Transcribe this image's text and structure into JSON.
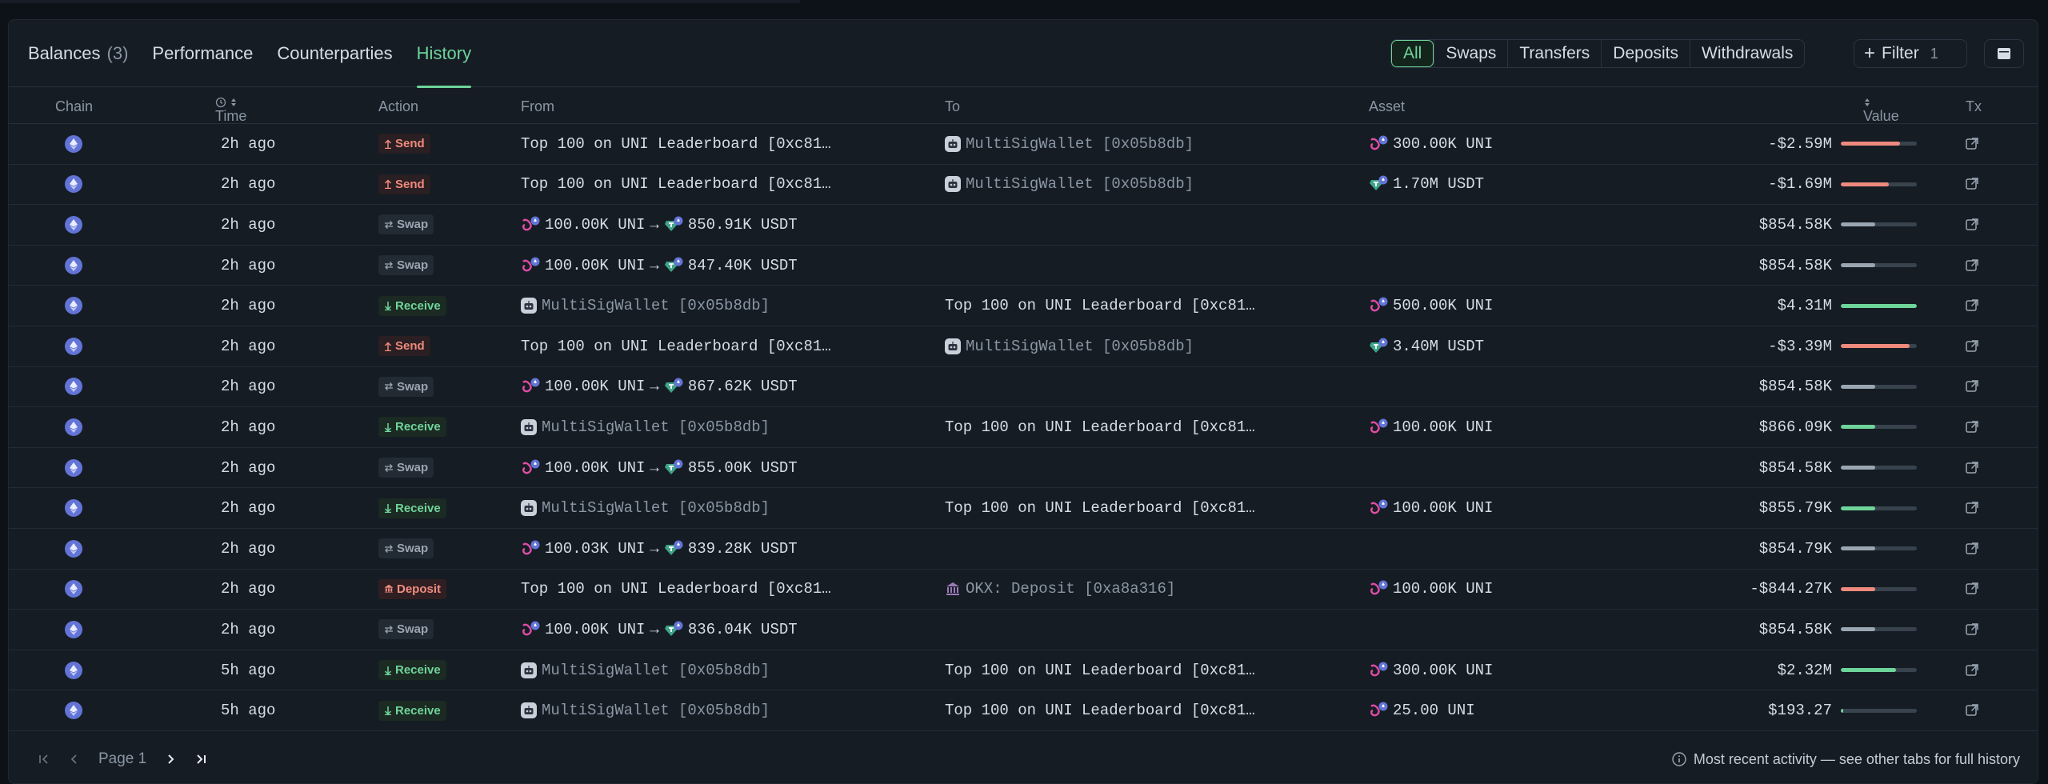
{
  "tabs": [
    {
      "label": "Balances",
      "count": "(3)"
    },
    {
      "label": "Performance",
      "count": ""
    },
    {
      "label": "Counterparties",
      "count": ""
    },
    {
      "label": "History",
      "count": ""
    }
  ],
  "active_tab": "History",
  "segments": [
    "All",
    "Swaps",
    "Transfers",
    "Deposits",
    "Withdrawals"
  ],
  "active_segment": "All",
  "filter": {
    "label": "Filter",
    "count": "1"
  },
  "columns": {
    "chain": "Chain",
    "time": "Time",
    "action": "Action",
    "from": "From",
    "to": "To",
    "asset": "Asset",
    "value": "Value",
    "tx": "Tx"
  },
  "rows": [
    {
      "time": "2h ago",
      "action": "Send",
      "kind": "send",
      "from": "Top 100 on UNI Leaderboard [0xc81…",
      "to": "MultiSigWallet [0x05b8db]",
      "asset": "300.00K UNI",
      "asset_token": "uni",
      "value": "-$2.59M",
      "bar": 0.78,
      "bar_color": "#ee8a7d"
    },
    {
      "time": "2h ago",
      "action": "Send",
      "kind": "send",
      "from": "Top 100 on UNI Leaderboard [0xc81…",
      "to": "MultiSigWallet [0x05b8db]",
      "asset": "1.70M USDT",
      "asset_token": "usdt",
      "value": "-$1.69M",
      "bar": 0.63,
      "bar_color": "#ee8a7d"
    },
    {
      "time": "2h ago",
      "action": "Swap",
      "kind": "swap",
      "from_swap_in": "100.00K UNI",
      "from_swap_out": "850.91K USDT",
      "value": "$854.58K",
      "bar": 0.45,
      "bar_color": "#9aa6b2"
    },
    {
      "time": "2h ago",
      "action": "Swap",
      "kind": "swap",
      "from_swap_in": "100.00K UNI",
      "from_swap_out": "847.40K USDT",
      "value": "$854.58K",
      "bar": 0.45,
      "bar_color": "#9aa6b2"
    },
    {
      "time": "2h ago",
      "action": "Receive",
      "kind": "receive",
      "from": "MultiSigWallet [0x05b8db]",
      "to": "Top 100 on UNI Leaderboard [0xc81…",
      "asset": "500.00K UNI",
      "asset_token": "uni",
      "value": "$4.31M",
      "bar": 1.0,
      "bar_color": "#6fd49a"
    },
    {
      "time": "2h ago",
      "action": "Send",
      "kind": "send",
      "from": "Top 100 on UNI Leaderboard [0xc81…",
      "to": "MultiSigWallet [0x05b8db]",
      "asset": "3.40M USDT",
      "asset_token": "usdt",
      "value": "-$3.39M",
      "bar": 0.9,
      "bar_color": "#ee8a7d"
    },
    {
      "time": "2h ago",
      "action": "Swap",
      "kind": "swap",
      "from_swap_in": "100.00K UNI",
      "from_swap_out": "867.62K USDT",
      "value": "$854.58K",
      "bar": 0.45,
      "bar_color": "#9aa6b2"
    },
    {
      "time": "2h ago",
      "action": "Receive",
      "kind": "receive",
      "from": "MultiSigWallet [0x05b8db]",
      "to": "Top 100 on UNI Leaderboard [0xc81…",
      "asset": "100.00K UNI",
      "asset_token": "uni",
      "value": "$866.09K",
      "bar": 0.45,
      "bar_color": "#6fd49a"
    },
    {
      "time": "2h ago",
      "action": "Swap",
      "kind": "swap",
      "from_swap_in": "100.00K UNI",
      "from_swap_out": "855.00K USDT",
      "value": "$854.58K",
      "bar": 0.45,
      "bar_color": "#9aa6b2"
    },
    {
      "time": "2h ago",
      "action": "Receive",
      "kind": "receive",
      "from": "MultiSigWallet [0x05b8db]",
      "to": "Top 100 on UNI Leaderboard [0xc81…",
      "asset": "100.00K UNI",
      "asset_token": "uni",
      "value": "$855.79K",
      "bar": 0.45,
      "bar_color": "#6fd49a"
    },
    {
      "time": "2h ago",
      "action": "Swap",
      "kind": "swap",
      "from_swap_in": "100.03K UNI",
      "from_swap_out": "839.28K USDT",
      "value": "$854.79K",
      "bar": 0.45,
      "bar_color": "#9aa6b2"
    },
    {
      "time": "2h ago",
      "action": "Deposit",
      "kind": "deposit",
      "from": "Top 100 on UNI Leaderboard [0xc81…",
      "to": "OKX: Deposit [0xa8a316]",
      "to_icon": "bank",
      "asset": "100.00K UNI",
      "asset_token": "uni",
      "value": "-$844.27K",
      "bar": 0.45,
      "bar_color": "#ee8a7d"
    },
    {
      "time": "2h ago",
      "action": "Swap",
      "kind": "swap",
      "from_swap_in": "100.00K UNI",
      "from_swap_out": "836.04K USDT",
      "value": "$854.58K",
      "bar": 0.45,
      "bar_color": "#9aa6b2"
    },
    {
      "time": "5h ago",
      "action": "Receive",
      "kind": "receive",
      "from": "MultiSigWallet [0x05b8db]",
      "to": "Top 100 on UNI Leaderboard [0xc81…",
      "asset": "300.00K UNI",
      "asset_token": "uni",
      "value": "$2.32M",
      "bar": 0.73,
      "bar_color": "#6fd49a"
    },
    {
      "time": "5h ago",
      "action": "Receive",
      "kind": "receive",
      "from": "MultiSigWallet [0x05b8db]",
      "to": "Top 100 on UNI Leaderboard [0xc81…",
      "asset": "25.00 UNI",
      "asset_token": "uni",
      "value": "$193.27",
      "bar": 0.03,
      "bar_color": "#6fd49a"
    }
  ],
  "pager": {
    "label": "Page 1"
  },
  "footer_note": "Most recent activity — see other tabs for full history",
  "colors": {
    "accent": "#6fd49a",
    "negative": "#ee8a7d",
    "neutral": "#9aa6b2",
    "eth": "#6274d6"
  }
}
